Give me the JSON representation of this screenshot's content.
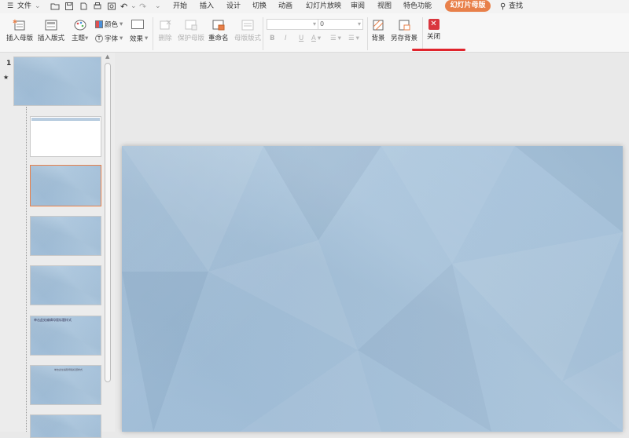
{
  "menu": {
    "file": "文件",
    "tabs": [
      "开始",
      "插入",
      "设计",
      "切换",
      "动画",
      "幻灯片放映",
      "审阅",
      "视图",
      "特色功能"
    ],
    "active_tab": "幻灯片母版",
    "search": "查找"
  },
  "ribbon": {
    "insert_master": "插入母版",
    "insert_layout": "插入版式",
    "theme": "主题",
    "colors": "颜色",
    "fonts": "字体",
    "effects": "效果",
    "delete": "删除",
    "preserve_master": "保护母版",
    "rename": "重命名",
    "master_layout": "母版版式",
    "font_size_value": "0",
    "background": "背景",
    "save_background": "另存背景",
    "close": "关闭"
  },
  "slides_panel": {
    "master_number": "1",
    "thumb4_title": "单击此处编辑母版标题样式",
    "thumb6_title": "单击此处编辑母版标题样式"
  },
  "colors": {
    "accent_orange": "#e8804a",
    "underline_red": "#e0242c",
    "slide_blue": "#a4c2dc",
    "close_red": "#d9363e"
  }
}
